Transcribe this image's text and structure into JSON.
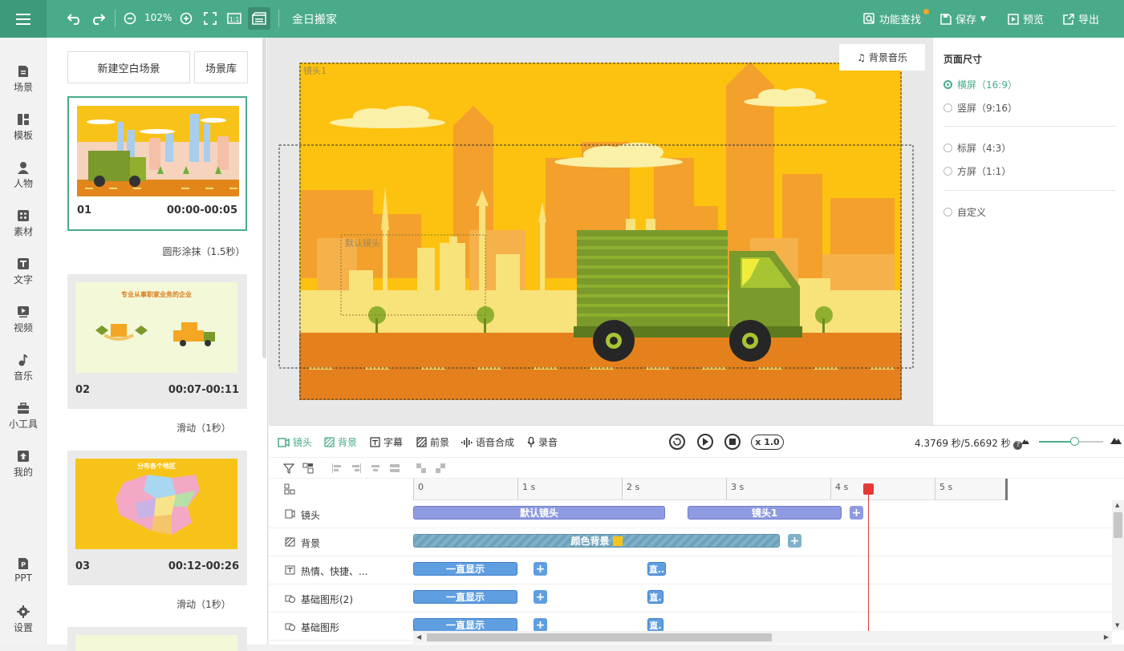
{
  "topbar": {
    "zoom": "102%",
    "title": "金日搬家",
    "feature_search": "功能查找",
    "save": "保存",
    "preview": "预览",
    "export": "导出"
  },
  "sidebar": {
    "items": [
      {
        "label": "场景",
        "icon": "scene-icon"
      },
      {
        "label": "模板",
        "icon": "template-icon"
      },
      {
        "label": "人物",
        "icon": "person-icon"
      },
      {
        "label": "素材",
        "icon": "material-icon"
      },
      {
        "label": "文字",
        "icon": "text-icon"
      },
      {
        "label": "视频",
        "icon": "video-icon"
      },
      {
        "label": "音乐",
        "icon": "music-icon"
      },
      {
        "label": "小工具",
        "icon": "toolbox-icon"
      },
      {
        "label": "我的",
        "icon": "upload-icon"
      },
      {
        "label": "PPT",
        "icon": "ppt-icon"
      },
      {
        "label": "设置",
        "icon": "gear-icon"
      }
    ]
  },
  "scenes": {
    "new_blank": "新建空白场景",
    "library": "场景库",
    "list": [
      {
        "num": "01",
        "time": "00:00-00:05",
        "transition": "圆形涂抹（1.5秒）"
      },
      {
        "num": "02",
        "time": "00:07-00:11",
        "transition": "滑动（1秒）",
        "thumb_title": "专业从事职家业务的企业"
      },
      {
        "num": "03",
        "time": "00:12-00:26",
        "transition": "滑动（1秒）",
        "thumb_title": "分布各个地区"
      }
    ]
  },
  "canvas": {
    "bg_music": "背景音乐",
    "camera1_label": "镜头1",
    "default_camera_label": "默认镜头"
  },
  "page_size": {
    "title": "页面尺寸",
    "options": [
      {
        "label": "横屏（16:9）",
        "selected": true
      },
      {
        "label": "竖屏（9:16）",
        "selected": false
      },
      {
        "label": "标屏（4:3）",
        "selected": false
      },
      {
        "label": "方屏（1:1）",
        "selected": false
      },
      {
        "label": "自定义",
        "selected": false
      }
    ]
  },
  "timeline": {
    "tabs": [
      "镜头",
      "背景",
      "字幕",
      "前景",
      "语音合成",
      "录音"
    ],
    "speed": "x 1.0",
    "time": "4.3769 秒/5.6692 秒",
    "zoom_level": 0.55,
    "ruler": [
      "0",
      "1 s",
      "2 s",
      "3 s",
      "4 s",
      "5 s"
    ],
    "rows": [
      {
        "label": "镜头",
        "clips": [
          "默认镜头",
          "镜头1"
        ]
      },
      {
        "label": "背景",
        "clips": [
          "颜色背景"
        ]
      },
      {
        "label": "热情、快捷、...",
        "clips": [
          "一直显示",
          "直.."
        ]
      },
      {
        "label": "基础图形(2)",
        "clips": [
          "一直显示",
          "直."
        ]
      },
      {
        "label": "基础图形",
        "clips": [
          "一直显示",
          "直."
        ]
      }
    ]
  },
  "colors": {
    "brand": "#4aab8b",
    "camera_clip": "#8f9be0",
    "clip_blue": "#5f9ee0",
    "playhead": "#e53935"
  }
}
